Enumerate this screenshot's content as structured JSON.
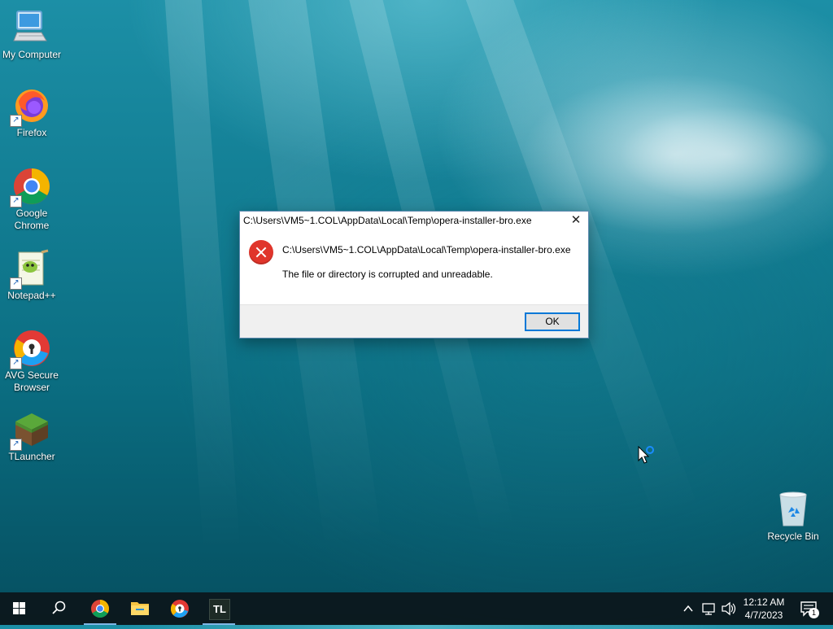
{
  "desktop": {
    "icons": [
      {
        "label": "My Computer",
        "icon": "computer-icon"
      },
      {
        "label": "Firefox",
        "icon": "firefox-icon"
      },
      {
        "label": "Google Chrome",
        "icon": "chrome-icon"
      },
      {
        "label": "Notepad++",
        "icon": "notepadpp-icon"
      },
      {
        "label": "AVG Secure Browser",
        "icon": "avg-browser-icon"
      },
      {
        "label": "TLauncher",
        "icon": "tlauncher-icon"
      }
    ],
    "recycle_bin": {
      "label": "Recycle Bin",
      "icon": "recycle-bin-icon"
    }
  },
  "dialog": {
    "title": "C:\\Users\\VM5~1.COL\\AppData\\Local\\Temp\\opera-installer-bro.exe",
    "message_path": "C:\\Users\\VM5~1.COL\\AppData\\Local\\Temp\\opera-installer-bro.exe",
    "message": "The file or directory is corrupted and unreadable.",
    "ok_label": "OK",
    "close_glyph": "✕",
    "icon": "error-icon"
  },
  "taskbar": {
    "apps": [
      {
        "name": "Google Chrome",
        "icon": "chrome-icon"
      },
      {
        "name": "File Explorer",
        "icon": "folder-icon"
      },
      {
        "name": "AVG Secure Browser",
        "icon": "avg-browser-icon"
      },
      {
        "name": "TLauncher",
        "icon": "tlauncher-icon",
        "text": "TL"
      }
    ],
    "clock": {
      "time": "12:12 AM",
      "date": "4/7/2023"
    },
    "notification_count": "1"
  }
}
